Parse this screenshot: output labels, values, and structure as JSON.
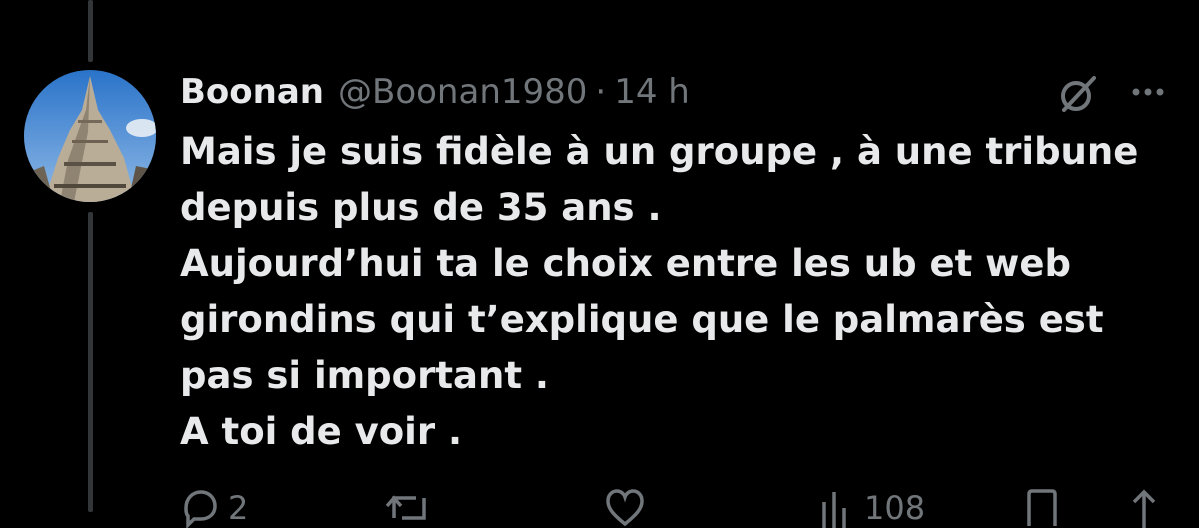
{
  "tweet": {
    "display_name": "Boonan",
    "handle": "@Boonan1980",
    "separator": "·",
    "time": "14 h",
    "lines": [
      "Mais je suis fidèle à un groupe , à une tribune",
      "depuis plus de 35 ans .",
      "Aujourd’hui ta le choix entre les ub et web",
      "girondins qui t’explique que le palmarès est",
      "pas si important .",
      "A toi de voir ."
    ]
  },
  "actions": {
    "reply_count": "2",
    "views_count": "108"
  },
  "icons": {
    "grok": "grok-icon",
    "more": "more-icon",
    "reply": "reply-icon",
    "retweet": "retweet-icon",
    "like": "like-icon",
    "views": "views-icon",
    "bookmark": "bookmark-icon",
    "share": "share-icon"
  },
  "colors": {
    "background": "#000000",
    "text_primary": "#e7e9ea",
    "text_secondary": "#71767b",
    "thread_line": "#333639"
  }
}
